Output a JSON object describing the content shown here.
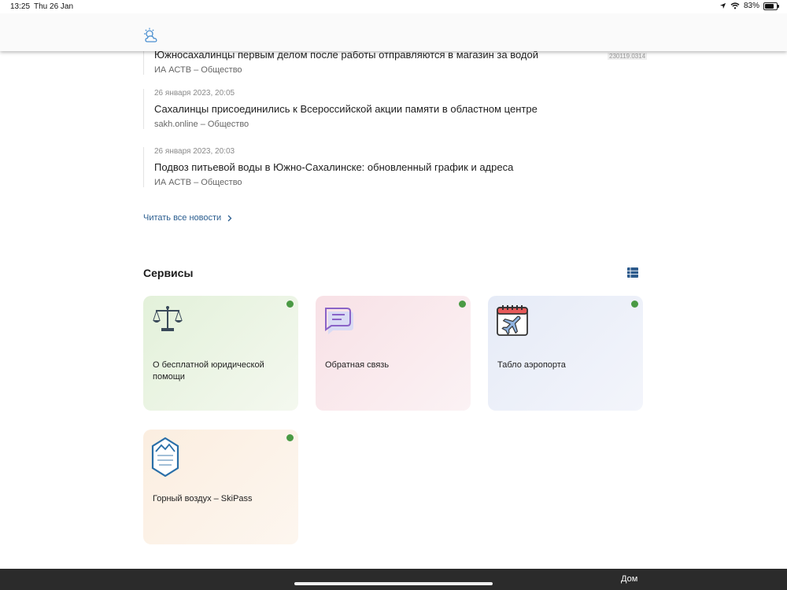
{
  "status_bar": {
    "time": "13:25",
    "date": "Thu 26 Jan",
    "battery": "83%"
  },
  "header": {
    "weather_icon": "partly-cloudy-icon"
  },
  "news": {
    "items": [
      {
        "date": "",
        "title": "Южносахалинцы первым делом после работы отправляются в магазин за водой",
        "source": "ИА АСТВ – Общество"
      },
      {
        "date": "26 января 2023, 20:05",
        "title": "Сахалинцы присоединились к Всероссийской акции памяти в областном центре",
        "source": "sakh.online – Общество"
      },
      {
        "date": "26 января 2023, 20:03",
        "title": "Подвоз питьевой воды в Южно-Сахалинске: обновленный график и адреса",
        "source": "ИА АСТВ – Общество"
      }
    ],
    "version_badge": "230119.0314",
    "read_all_label": "Читать все новости"
  },
  "services": {
    "title": "Сервисы",
    "cards": [
      {
        "label": "О бесплатной юридической помощи",
        "icon": "scales-icon",
        "color": "#e3f1da"
      },
      {
        "label": "Обратная связь",
        "icon": "chat-bubble-icon",
        "color": "#f8e1e6"
      },
      {
        "label": "Табло аэропорта",
        "icon": "calendar-plane-icon",
        "color": "#e6ebf7"
      },
      {
        "label": "Горный воздух – SkiPass",
        "icon": "mountain-air-logo",
        "color": "#fbeee0"
      }
    ],
    "status_color": "#4a9a44"
  },
  "bottom_bar": {
    "label": "Дом"
  },
  "colors": {
    "link": "#2a5d8f",
    "grid_icon": "#2c5a8c"
  }
}
